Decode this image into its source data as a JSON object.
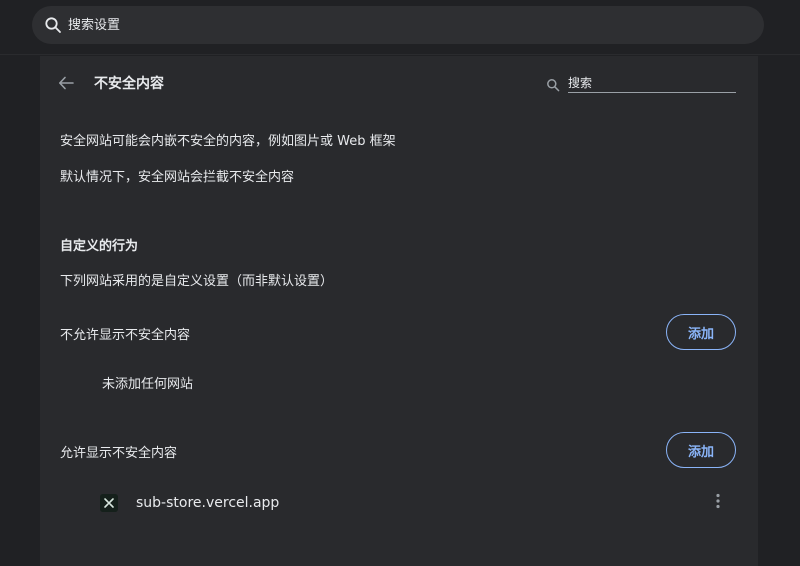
{
  "top_search": {
    "placeholder": "搜索设置",
    "icon": "search-icon"
  },
  "page": {
    "title": "不安全内容",
    "back_icon": "arrow-back-icon",
    "search_placeholder": "搜索",
    "search_icon": "search-icon"
  },
  "description": {
    "line1": "安全网站可能会内嵌不安全的内容，例如图片或 Web 框架",
    "line2": "默认情况下，安全网站会拦截不安全内容"
  },
  "custom": {
    "title": "自定义的行为",
    "subtitle": "下列网站采用的是自定义设置（而非默认设置）"
  },
  "blocked": {
    "title": "不允许显示不安全内容",
    "add_label": "添加",
    "empty_text": "未添加任何网站"
  },
  "allowed": {
    "title": "允许显示不安全内容",
    "add_label": "添加",
    "sites": [
      {
        "name": "sub-store.vercel.app",
        "favicon": "site-favicon-icon",
        "menu_icon": "more-vert-icon"
      }
    ]
  },
  "colors": {
    "background": "#202124",
    "card": "#292a2d",
    "text": "#e8eaed",
    "accent": "#8ab4f8"
  }
}
